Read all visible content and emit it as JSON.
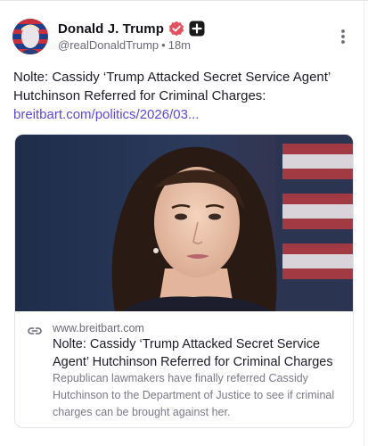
{
  "post": {
    "author": {
      "display_name": "Donald J. Trump",
      "handle": "@realDonaldTrump",
      "time_ago": "18m",
      "separator": "•",
      "verified_icon": "verified-badge-icon",
      "plus_icon": "plus-badge-icon",
      "verified_color": "#e2525f"
    },
    "text": "Nolte: Cassidy ‘Trump Attacked Secret Service Agent’ Hutchinson Referred for Criminal Charges:",
    "link_text": "breitbart.com/politics/2026/03...",
    "link_color": "#5b48d4",
    "more_icon": "more-vertical-icon",
    "card": {
      "link_icon": "link-icon",
      "domain": "www.breitbart.com",
      "title": "Nolte: Cassidy ‘Trump Attacked Secret Service Agent’ Hutchinson Referred for Criminal Charges",
      "description": "Republican lawmakers have finally referred Cassidy Hutchinson to the Department of Justice to see if criminal charges can be brought against her."
    }
  }
}
